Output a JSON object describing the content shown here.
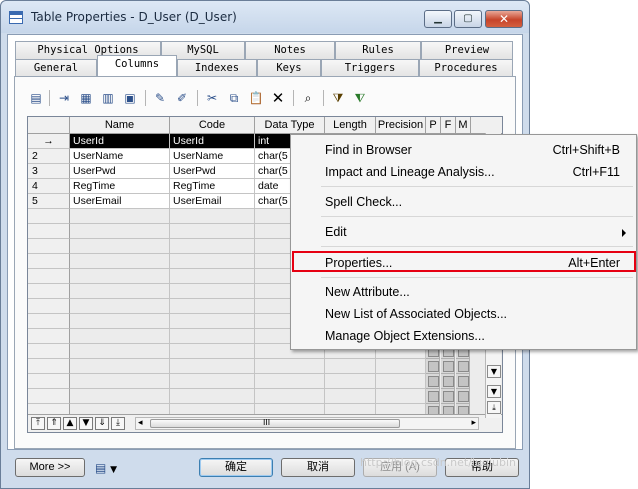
{
  "window": {
    "title": "Table Properties - D_User (D_User)",
    "minimize_glyph": "▁",
    "maximize_glyph": "▢",
    "close_glyph": "✕"
  },
  "tabs": {
    "top_row": [
      "Physical Options",
      "MySQL",
      "Notes",
      "Rules",
      "Preview"
    ],
    "bottom_row": [
      "General",
      "Columns",
      "Indexes",
      "Keys",
      "Triggers",
      "Procedures"
    ],
    "active": "Columns"
  },
  "toolbar": {
    "icons": [
      "properties-icon",
      "insert-row-icon",
      "add-row-icon",
      "add-column-icon",
      "select-all-icon",
      "new-icon",
      "edit-icon",
      "cut-icon",
      "copy-icon",
      "paste-icon",
      "delete-icon",
      "find-icon",
      "filter-icon",
      "clear-filter-icon"
    ]
  },
  "grid": {
    "headers": [
      "Name",
      "Code",
      "Data Type",
      "Length",
      "Precision",
      "P",
      "F",
      "M"
    ],
    "rows": [
      {
        "row_label": "→",
        "name": "UserId",
        "code": "UserId",
        "data_type": "int"
      },
      {
        "row_label": "2",
        "name": "UserName",
        "code": "UserName",
        "data_type": "char(5"
      },
      {
        "row_label": "3",
        "name": "UserPwd",
        "code": "UserPwd",
        "data_type": "char(5"
      },
      {
        "row_label": "4",
        "name": "RegTime",
        "code": "RegTime",
        "data_type": "date"
      },
      {
        "row_label": "5",
        "name": "UserEmail",
        "code": "UserEmail",
        "data_type": "char(5"
      }
    ],
    "nav_buttons": [
      "⤒",
      "⇑",
      "▲",
      "▼",
      "⇓",
      "⤓"
    ],
    "hscroll_left": "◂",
    "hscroll_right": "▸",
    "hscroll_grip": "III"
  },
  "context_menu": {
    "items": [
      {
        "label": "Find in Browser",
        "shortcut": "Ctrl+Shift+B"
      },
      {
        "label": "Impact and Lineage Analysis...",
        "shortcut": "Ctrl+F11"
      },
      {
        "label": "Spell Check...",
        "shortcut": ""
      },
      {
        "label": "Edit",
        "shortcut": ""
      },
      {
        "label": "Properties...",
        "shortcut": "Alt+Enter"
      },
      {
        "label": "New Attribute...",
        "shortcut": ""
      },
      {
        "label": "New List of Associated Objects...",
        "shortcut": ""
      },
      {
        "label": "Manage Object Extensions...",
        "shortcut": ""
      }
    ]
  },
  "footer": {
    "more": "More >>",
    "ok": "确定",
    "cancel": "取消",
    "apply": "应用 (A)",
    "help": "帮助"
  },
  "watermark": "http://blog.csdn.net/luqiubin"
}
